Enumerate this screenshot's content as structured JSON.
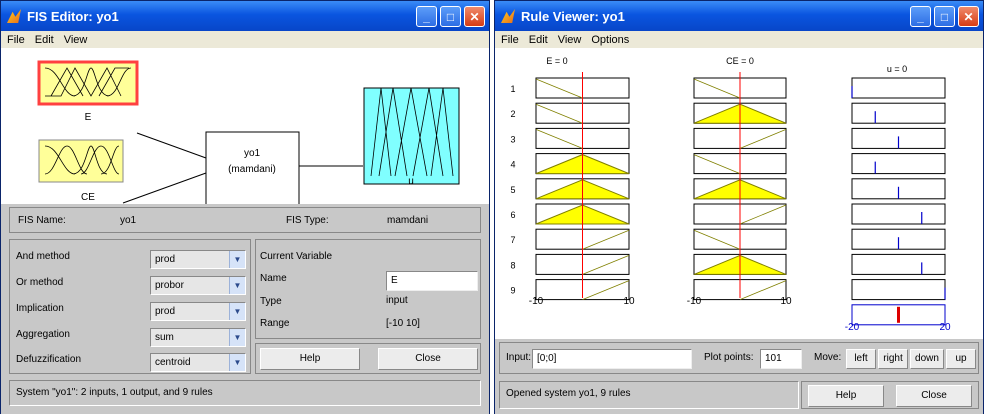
{
  "fis_editor": {
    "title": "FIS Editor: yo1",
    "menu": [
      "File",
      "Edit",
      "View"
    ],
    "diagram": {
      "input1": "E",
      "input2": "CE",
      "system_name": "yo1",
      "system_type": "(mamdani)",
      "output": "u"
    },
    "fis_name_label": "FIS Name:",
    "fis_name_value": "yo1",
    "fis_type_label": "FIS Type:",
    "fis_type_value": "mamdani",
    "methods": [
      {
        "label": "And method",
        "value": "prod"
      },
      {
        "label": "Or method",
        "value": "probor"
      },
      {
        "label": "Implication",
        "value": "prod"
      },
      {
        "label": "Aggregation",
        "value": "sum"
      },
      {
        "label": "Defuzzification",
        "value": "centroid"
      }
    ],
    "current_variable": {
      "heading": "Current Variable",
      "name_label": "Name",
      "name_value": "E",
      "type_label": "Type",
      "type_value": "input",
      "range_label": "Range",
      "range_value": "[-10 10]"
    },
    "help_label": "Help",
    "close_label": "Close",
    "status": "System \"yo1\": 2 inputs, 1 output, and 9 rules",
    "colors": {
      "input_fill": "#ffff99",
      "output_fill": "#80ffff",
      "selected_border": "#ff4040"
    }
  },
  "rule_viewer": {
    "title": "Rule Viewer: yo1",
    "menu": [
      "File",
      "Edit",
      "View",
      "Options"
    ],
    "col_headers": [
      "E = 0",
      "CE = 0",
      "u = 0"
    ],
    "rule_numbers": [
      "1",
      "2",
      "3",
      "4",
      "5",
      "6",
      "7",
      "8",
      "9"
    ],
    "axis_e": [
      "-10",
      "10"
    ],
    "axis_ce": [
      "-10",
      "10"
    ],
    "axis_u": [
      "-20",
      "20"
    ],
    "input_label": "Input:",
    "input_value": "[0;0]",
    "plot_points_label": "Plot points:",
    "plot_points_value": "101",
    "move_label": "Move:",
    "move_buttons": [
      "left",
      "right",
      "down",
      "up"
    ],
    "status": "Opened system yo1, 9 rules",
    "help_label": "Help",
    "close_label": "Close",
    "e_shapes": [
      "zdown",
      "zdown",
      "zdown",
      "tri",
      "tri",
      "tri",
      "zup",
      "zup",
      "zup"
    ],
    "ce_shapes": [
      "zdown",
      "tri",
      "zup",
      "zdown",
      "tri",
      "zup",
      "zdown",
      "tri",
      "zup"
    ],
    "e_fill": [
      false,
      false,
      false,
      true,
      true,
      true,
      false,
      false,
      false
    ],
    "ce_fill": [
      false,
      true,
      false,
      false,
      true,
      false,
      false,
      true,
      false
    ],
    "u_spikes": [
      0.0,
      0.25,
      0.5,
      0.25,
      0.5,
      0.75,
      0.5,
      0.75,
      1.0
    ],
    "colors": {
      "fill": "#ffff00",
      "line": "#808000",
      "indicator": "#ff0000",
      "spike": "#0000cc",
      "agg": "#dd0000"
    }
  }
}
